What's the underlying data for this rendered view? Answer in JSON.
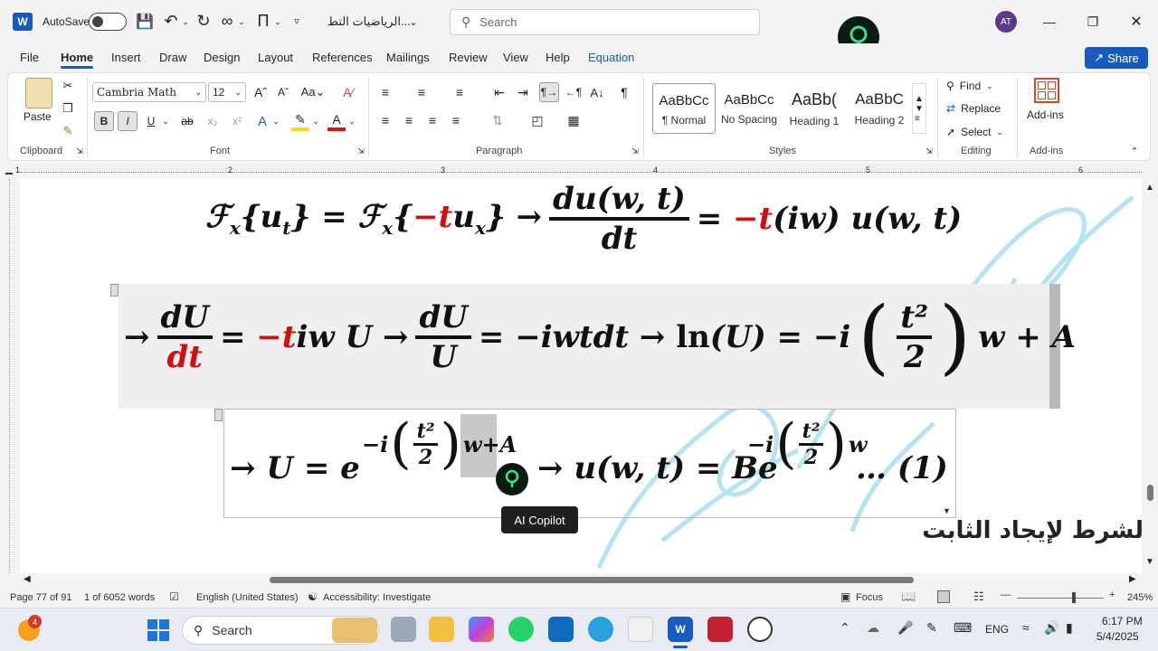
{
  "titlebar": {
    "autosave_label": "AutoSave",
    "doc_title": "الرياضيات التط...",
    "search_placeholder": "Search",
    "avatar_initials": "AT"
  },
  "menu": [
    "File",
    "Home",
    "Insert",
    "Draw",
    "Design",
    "Layout",
    "References",
    "Mailings",
    "Review",
    "View",
    "Help",
    "Equation"
  ],
  "share_label": "Share",
  "ribbon": {
    "paste_label": "Paste",
    "clipboard_label": "Clipboard",
    "font_name": "Cambria Math",
    "font_size": "12",
    "font_label": "Font",
    "paragraph_label": "Paragraph",
    "styles_label": "Styles",
    "styles": [
      {
        "preview": "AaBbCc",
        "name": "¶ Normal"
      },
      {
        "preview": "AaBbCc",
        "name": "No Spacing"
      },
      {
        "preview": "AaBb(",
        "name": "Heading 1"
      },
      {
        "preview": "AaBbC",
        "name": "Heading 2"
      }
    ],
    "find_label": "Find",
    "replace_label": "Replace",
    "select_label": "Select",
    "editing_label": "Editing",
    "addins_label": "Add-ins",
    "addins_group_label": "Add-ins"
  },
  "ruler_numbers": [
    "1",
    "2",
    "3",
    "4",
    "5",
    "6"
  ],
  "tooltip": "AI Copilot",
  "arabic_text": "لشرط لإيجاد الثابت",
  "status": {
    "page": "Page 77 of 91",
    "words": "1 of 6052 words",
    "language": "English (United States)",
    "accessibility": "Accessibility: Investigate",
    "focus": "Focus",
    "zoom": "245%"
  },
  "taskbar": {
    "search": "Search",
    "lang": "ENG",
    "time": "6:17 PM",
    "date": "5/4/2025",
    "badge": "4"
  }
}
